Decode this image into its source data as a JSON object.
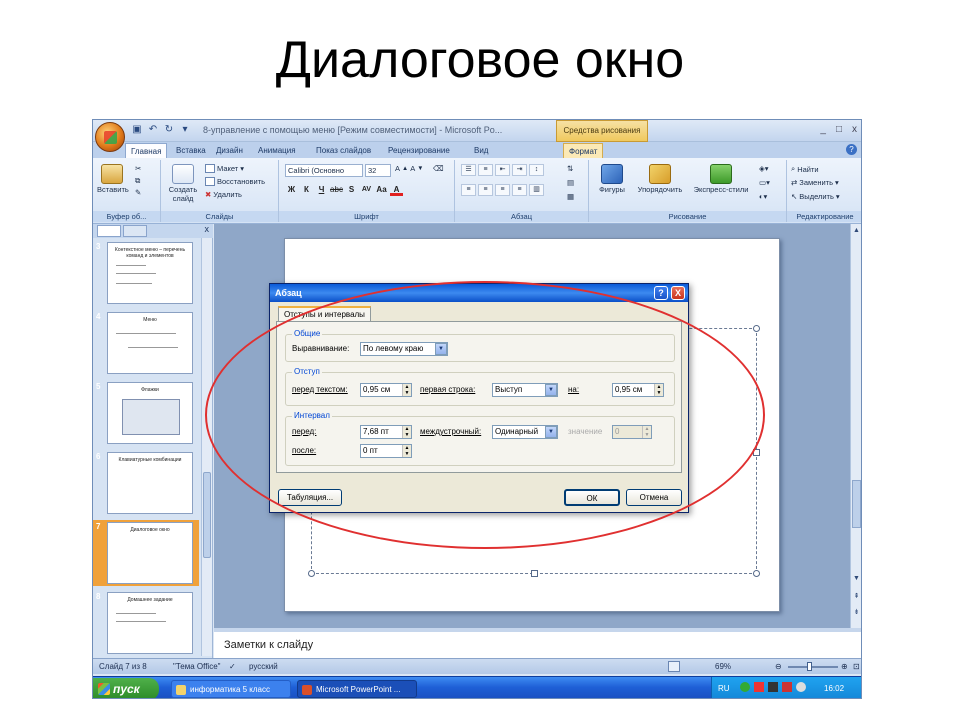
{
  "slide_title": "Диалоговое окно",
  "window": {
    "title": "8-управление с помощью меню [Режим совместимости] - Microsoft Po...",
    "context_tab_header": "Средства рисования",
    "controls": [
      "_",
      "□",
      "x"
    ]
  },
  "tabs": [
    "Главная",
    "Вставка",
    "Дизайн",
    "Анимация",
    "Показ слайдов",
    "Рецензирование",
    "Вид",
    "Формат"
  ],
  "ribbon": {
    "clipboard": {
      "label": "Буфер об...",
      "paste": "Вставить"
    },
    "slides": {
      "label": "Слайды",
      "new_slide": "Создать слайд",
      "layout": "Макет",
      "reset": "Восстановить",
      "delete": "Удалить"
    },
    "font": {
      "label": "Шрифт",
      "font_name": "Calibri (Основно",
      "font_size": "32",
      "bold": "Ж",
      "italic": "К",
      "underline": "Ч",
      "strike": "abc",
      "shadow": "S",
      "spacing": "AV",
      "case": "Аа",
      "color": "A"
    },
    "paragraph": {
      "label": "Абзац"
    },
    "drawing": {
      "label": "Рисование",
      "shapes": "Фигуры",
      "arrange": "Упорядочить",
      "quick_styles": "Экспресс-стили"
    },
    "editing": {
      "label": "Редактирование",
      "find": "Найти",
      "replace": "Заменить",
      "select": "Выделить"
    }
  },
  "slides": [
    {
      "num": "3",
      "title": "Контекстное меню – перечень команд и элементов"
    },
    {
      "num": "4",
      "title": "Меню"
    },
    {
      "num": "5",
      "title": "Флажки"
    },
    {
      "num": "6",
      "title": "Клавиатурные комбинации"
    },
    {
      "num": "7",
      "title": "Диалоговое окно",
      "selected": true
    },
    {
      "num": "8",
      "title": "Домашнее задание"
    }
  ],
  "dialog": {
    "title": "Абзац",
    "help": "?",
    "close": "X",
    "tab": "Отступы и интервалы",
    "general": {
      "legend": "Общие",
      "alignment_label": "Выравнивание:",
      "alignment_value": "По левому краю"
    },
    "indent": {
      "legend": "Отступ",
      "before_label": "перед текстом:",
      "before_value": "0,95 см",
      "first_line_label": "первая строка:",
      "first_line_value": "Выступ",
      "by_label": "на:",
      "by_value": "0,95 см"
    },
    "spacing": {
      "legend": "Интервал",
      "before_label": "перед:",
      "before_value": "7,68 пт",
      "after_label": "после:",
      "after_value": "0 пт",
      "line_label": "междустрочный:",
      "line_value": "Одинарный",
      "at_label": "значение",
      "at_value": "0"
    },
    "tabs_button": "Табуляция...",
    "ok_button": "ОК",
    "cancel_button": "Отмена"
  },
  "notes_placeholder": "Заметки к слайду",
  "status": {
    "slide": "Слайд 7 из 8",
    "theme": "\"Тема Office\"",
    "language": "русский",
    "zoom": "69%"
  },
  "taskbar": {
    "start": "пуск",
    "tasks": [
      "информатика 5 класс",
      "Microsoft PowerPoint ..."
    ],
    "lang": "RU",
    "time": "16:02"
  },
  "colors": {
    "highlight_ellipse": "#e03030",
    "selected_slide": "#f0a13a"
  }
}
